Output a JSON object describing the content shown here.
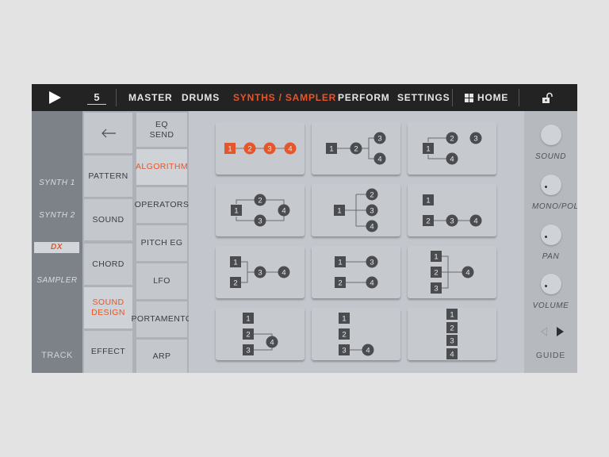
{
  "topbar": {
    "bar_number": "5",
    "nav": [
      {
        "label": "MASTER",
        "active": false
      },
      {
        "label": "DRUMS",
        "active": false
      },
      {
        "label": "SYNTHS / SAMPLER",
        "active": true
      },
      {
        "label": "PERFORM",
        "active": false
      },
      {
        "label": "SETTINGS",
        "active": false
      }
    ],
    "home_label": "HOME",
    "icons": {
      "play": "play-icon",
      "home": "grid-icon",
      "lock": "unlock-icon"
    }
  },
  "tracks": {
    "items": [
      {
        "label": "SYNTH 1",
        "selected": false
      },
      {
        "label": "SYNTH 2",
        "selected": false
      },
      {
        "label": "DX",
        "selected": true
      },
      {
        "label": "SAMPLER",
        "selected": false
      }
    ],
    "footer_label": "TRACK"
  },
  "menu1": {
    "back_icon": "arrow-left-icon",
    "items": [
      {
        "label": "PATTERN",
        "active": false
      },
      {
        "label": "SOUND",
        "active": false
      },
      {
        "label": "CHORD",
        "active": false
      },
      {
        "label": "SOUND DESIGN",
        "active": true
      },
      {
        "label": "EFFECT",
        "active": false
      }
    ]
  },
  "menu2": {
    "items": [
      {
        "label": "EQ SEND",
        "active": false
      },
      {
        "label": "ALGORITHM",
        "active": true
      },
      {
        "label": "OPERATORS",
        "active": false
      },
      {
        "label": "PITCH EG",
        "active": false
      },
      {
        "label": "LFO",
        "active": false
      },
      {
        "label": "PORTAMENTO",
        "active": false
      },
      {
        "label": "ARP",
        "active": false
      }
    ]
  },
  "algorithms": {
    "selected_index": 0,
    "accent_color": "#e5562a",
    "operator_color": "#4a4c4f",
    "cards": [
      {
        "id": 1,
        "ops": [
          "1",
          "2",
          "3",
          "4"
        ],
        "description": "1 -> 2 -> 3 -> 4 (serial)"
      },
      {
        "id": 2,
        "ops": [
          "1",
          "2",
          "3",
          "4"
        ],
        "description": "1 -> 2 -> (3, 4)"
      },
      {
        "id": 3,
        "ops": [
          "1",
          "2",
          "3",
          "4"
        ],
        "description": "1 -> (2, 4), 3"
      },
      {
        "id": 4,
        "ops": [
          "1",
          "2",
          "3",
          "4"
        ],
        "description": "1 -> (2, 3) -> 4"
      },
      {
        "id": 5,
        "ops": [
          "1",
          "2",
          "3",
          "4"
        ],
        "description": "1 -> (2, 3, 4)"
      },
      {
        "id": 6,
        "ops": [
          "1",
          "2",
          "3",
          "4"
        ],
        "description": "1, 2 -> 3 -> 4"
      },
      {
        "id": 7,
        "ops": [
          "1",
          "2",
          "3",
          "4"
        ],
        "description": "(1, 2) -> 3 -> 4"
      },
      {
        "id": 8,
        "ops": [
          "1",
          "2",
          "3",
          "4"
        ],
        "description": "1 -> 2, 3 -> 4"
      },
      {
        "id": 9,
        "ops": [
          "1",
          "2",
          "3",
          "4"
        ],
        "description": "(1, 2, 3) -> 4"
      },
      {
        "id": 10,
        "ops": [
          "1",
          "2",
          "3",
          "4"
        ],
        "description": "1, (2, 3) -> 4"
      },
      {
        "id": 11,
        "ops": [
          "1",
          "2",
          "3",
          "4"
        ],
        "description": "1, 2, 3 -> 4"
      },
      {
        "id": 12,
        "ops": [
          "1",
          "2",
          "3",
          "4"
        ],
        "description": "1, 2, 3, 4 (parallel)"
      }
    ]
  },
  "right_panel": {
    "knobs": [
      {
        "label": "SOUND",
        "value": null
      },
      {
        "label": "MONO/POLY",
        "value": 0.0
      },
      {
        "label": "PAN",
        "value": 0.0
      },
      {
        "label": "VOLUME",
        "value": 0.0
      }
    ],
    "guide_label": "GUIDE",
    "guide_prev_icon": "triangle-left-icon",
    "guide_next_icon": "triangle-right-icon"
  }
}
